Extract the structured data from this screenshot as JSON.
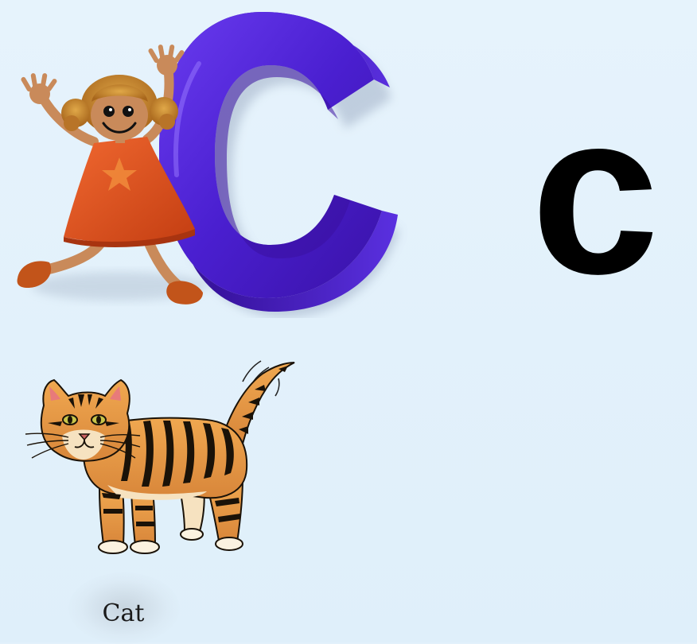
{
  "letter": {
    "lowercase": "c",
    "uppercase_color": "#4a1fd0",
    "lowercase_color": "#000000"
  },
  "picture": {
    "word": "Cat"
  },
  "colors": {
    "background": "#e3f1fb",
    "dress": "#e0531e",
    "hair": "#c98a2e",
    "skin": "#c98a5a",
    "cat_fur": "#e8a050",
    "cat_stripes": "#1a1208"
  },
  "icons": {
    "girl": "girl-figure-icon",
    "uppercase_letter": "uppercase-letter-c-3d",
    "cat": "tabby-cat-icon"
  }
}
